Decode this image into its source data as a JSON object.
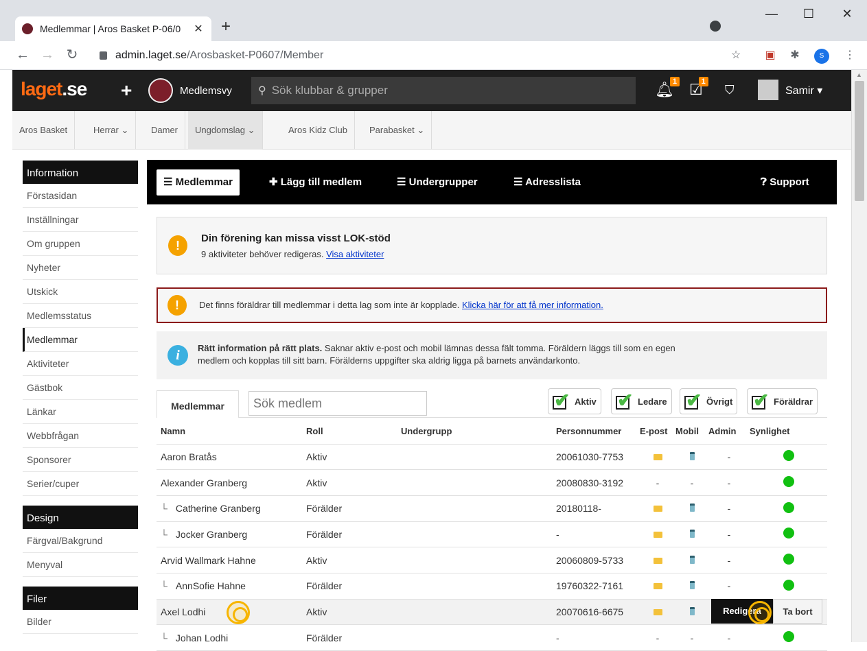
{
  "browser": {
    "tab_title": "Medlemmar | Aros Basket P-06/0",
    "url_host": "admin.laget.se",
    "url_path": "/Arosbasket-P0607/Member"
  },
  "header": {
    "logo_main": "laget",
    "logo_suffix": ".se",
    "view_label": "Medlemsvy",
    "search_placeholder": "Sök klubbar & grupper",
    "notif_count": "1",
    "task_count": "1",
    "user_name": "Samir"
  },
  "topnav": [
    "Aros Basket",
    "Herrar ⌄",
    "Damer",
    "Ungdomslag ⌄",
    "Aros Kidz Club",
    "Parabasket ⌄"
  ],
  "sidebar": {
    "information_title": "Information",
    "information_items": [
      "Förstasidan",
      "Inställningar",
      "Om gruppen",
      "Nyheter",
      "Utskick",
      "Medlemsstatus",
      "Medlemmar",
      "Aktiviteter",
      "Gästbok",
      "Länkar",
      "Webbfrågan",
      "Sponsorer",
      "Serier/cuper"
    ],
    "design_title": "Design",
    "design_items": [
      "Färgval/Bakgrund",
      "Menyval"
    ],
    "files_title": "Filer",
    "files_items": [
      "Bilder"
    ]
  },
  "toolbar": {
    "members": "Medlemmar",
    "add_member": "Lägg till medlem",
    "subgroups": "Undergrupper",
    "address_list": "Adresslista",
    "support": "Support"
  },
  "alerts": {
    "lok_title": "Din förening kan missa visst LOK-stöd",
    "lok_text": "9 aktiviteter behöver redigeras.",
    "lok_link": "Visa aktiviteter",
    "parents_text": "Det finns föräldrar till medlemmar i detta lag som inte är kopplade.",
    "parents_link": "Klicka här för att få mer information.",
    "info_bold": "Rätt information på rätt plats.",
    "info_text": "Saknar aktiv e-post och mobil lämnas dessa fält tomma. Föräldern läggs till som en egen",
    "info_text2": "medlem och kopplas till sitt barn. Förälderns uppgifter ska aldrig ligga på barnets användarkonto."
  },
  "member_tab": "Medlemmar",
  "member_search_placeholder": "Sök medlem",
  "filters": [
    "Aktiv",
    "Ledare",
    "Övrigt",
    "Föräldrar"
  ],
  "table": {
    "headers": [
      "Namn",
      "Roll",
      "Undergrupp",
      "Personnummer",
      "E-post",
      "Mobil",
      "Admin",
      "Synlighet"
    ],
    "rows": [
      {
        "name": "Aaron Bratås",
        "child": false,
        "role": "Aktiv",
        "pnr": "20061030-7753",
        "email": true,
        "mobile": true
      },
      {
        "name": "Alexander Granberg",
        "child": false,
        "role": "Aktiv",
        "pnr": "20080830-3192",
        "email": false,
        "mobile": false
      },
      {
        "name": "Catherine Granberg",
        "child": true,
        "role": "Förälder",
        "pnr": "20180118-",
        "email": true,
        "mobile": true
      },
      {
        "name": "Jocker Granberg",
        "child": true,
        "role": "Förälder",
        "pnr": "-",
        "email": true,
        "mobile": true
      },
      {
        "name": "Arvid Wallmark Hahne",
        "child": false,
        "role": "Aktiv",
        "pnr": "20060809-5733",
        "email": true,
        "mobile": true
      },
      {
        "name": "AnnSofie Hahne",
        "child": true,
        "role": "Förälder",
        "pnr": "19760322-7161",
        "email": true,
        "mobile": true
      },
      {
        "name": "Axel Lodhi",
        "child": false,
        "role": "Aktiv",
        "pnr": "20070616-6675",
        "email": true,
        "mobile": true
      },
      {
        "name": "Johan Lodhi",
        "child": true,
        "role": "Förälder",
        "pnr": "-",
        "email": false,
        "mobile": false
      }
    ],
    "dash": "-",
    "edit_button": "Redigera",
    "delete_button": "Ta bort"
  }
}
